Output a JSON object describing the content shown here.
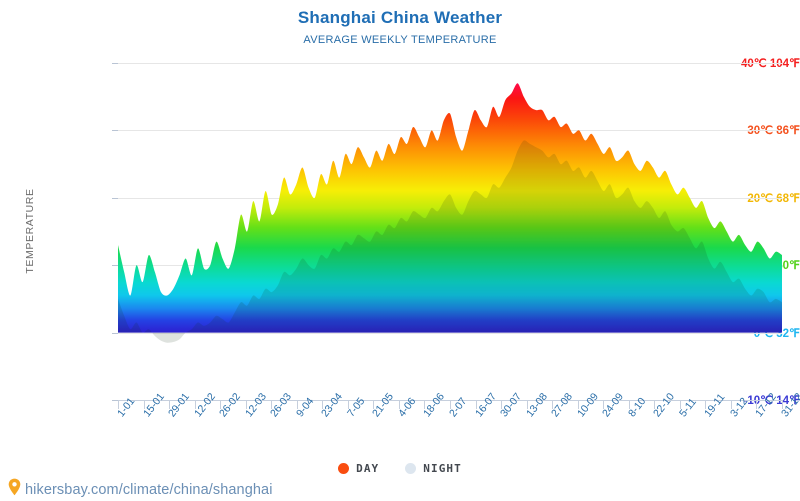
{
  "header": {
    "title": "Shanghai China Weather",
    "subtitle": "AVERAGE WEEKLY TEMPERATURE"
  },
  "axes": {
    "y_title": "TEMPERATURE"
  },
  "legend": {
    "items": [
      {
        "label": "DAY",
        "color": "#f94d10"
      },
      {
        "label": "NIGHT",
        "color": "#dde6ef"
      }
    ]
  },
  "footer": {
    "url": "hikersbay.com/climate/china/shanghai",
    "pin_icon": "map-pin-icon",
    "pin_color": "#f5a623"
  },
  "chart_data": {
    "type": "area",
    "title": "Shanghai China Weather",
    "subtitle": "AVERAGE WEEKLY TEMPERATURE",
    "xlabel": "",
    "ylabel": "TEMPERATURE",
    "ylim": [
      -10,
      40
    ],
    "grid": true,
    "legend_position": "bottom-center",
    "y_ticks": [
      {
        "value": 40,
        "label": "40℃ 104℉",
        "color": "#f41f1f"
      },
      {
        "value": 30,
        "label": "30℃ 86℉",
        "color": "#f4511e"
      },
      {
        "value": 20,
        "label": "20℃ 68℉",
        "color": "#f2b705"
      },
      {
        "value": 10,
        "label": "10℃ 50℉",
        "color": "#52d11a"
      },
      {
        "value": 0,
        "label": "0℃ 32℉",
        "color": "#1fb6f0"
      },
      {
        "value": -10,
        "label": "-10℃ 14℉",
        "color": "#3a3ad4"
      }
    ],
    "categories": [
      "1-01",
      "15-01",
      "29-01",
      "12-02",
      "26-02",
      "12-03",
      "26-03",
      "9-04",
      "23-04",
      "7-05",
      "21-05",
      "4-06",
      "18-06",
      "2-07",
      "16-07",
      "30-07",
      "13-08",
      "27-08",
      "10-09",
      "24-09",
      "8-10",
      "22-10",
      "5-11",
      "19-11",
      "3-12",
      "17-12",
      "31-12"
    ],
    "series": [
      {
        "name": "DAY",
        "color": "#f94d10",
        "values": [
          13.0,
          9.0,
          5.5,
          10.0,
          7.5,
          11.5,
          9.0,
          6.0,
          5.5,
          6.5,
          8.5,
          11.0,
          8.5,
          12.5,
          9.5,
          10.0,
          13.5,
          11.0,
          9.5,
          12.5,
          17.5,
          15.0,
          19.5,
          16.5,
          21.0,
          17.5,
          19.0,
          23.0,
          20.5,
          22.0,
          24.5,
          21.5,
          20.0,
          23.5,
          22.0,
          25.5,
          23.0,
          26.5,
          25.0,
          27.5,
          26.0,
          24.5,
          27.0,
          25.5,
          28.0,
          26.5,
          29.0,
          28.0,
          30.5,
          29.0,
          27.5,
          30.0,
          28.5,
          31.5,
          32.5,
          29.0,
          27.0,
          30.0,
          33.0,
          31.5,
          30.5,
          33.5,
          32.0,
          34.5,
          35.5,
          37.0,
          35.0,
          33.5,
          33.0,
          33.0,
          31.5,
          32.0,
          30.5,
          31.0,
          29.5,
          30.0,
          28.5,
          29.5,
          28.0,
          26.5,
          27.5,
          25.5,
          26.0,
          27.0,
          25.0,
          24.0,
          25.5,
          24.5,
          23.0,
          24.0,
          22.0,
          20.5,
          21.5,
          20.0,
          18.5,
          19.5,
          17.0,
          15.5,
          16.5,
          15.0,
          13.5,
          14.5,
          13.0,
          12.0,
          13.5,
          12.5,
          11.0,
          12.0,
          11.5
        ]
      },
      {
        "name": "NIGHT",
        "color": "#dde6ef",
        "values": [
          5.0,
          2.5,
          0.5,
          1.5,
          0.0,
          0.5,
          -0.5,
          -1.2,
          -1.5,
          -1.4,
          -1.0,
          0.0,
          0.5,
          1.5,
          1.0,
          1.5,
          2.5,
          2.0,
          1.5,
          3.0,
          4.5,
          4.0,
          5.5,
          5.0,
          6.5,
          6.0,
          7.0,
          9.0,
          8.5,
          9.5,
          11.0,
          10.0,
          9.5,
          11.5,
          11.0,
          12.5,
          12.0,
          13.5,
          13.0,
          14.5,
          14.0,
          13.5,
          15.0,
          14.5,
          16.0,
          15.5,
          17.0,
          16.5,
          18.0,
          17.5,
          17.0,
          18.5,
          18.0,
          19.5,
          20.5,
          18.5,
          17.5,
          19.5,
          21.0,
          20.5,
          20.0,
          22.0,
          21.5,
          23.0,
          24.5,
          27.0,
          28.5,
          28.0,
          27.5,
          27.0,
          26.0,
          26.5,
          25.0,
          25.5,
          24.0,
          24.5,
          23.0,
          24.0,
          22.5,
          21.0,
          22.0,
          20.0,
          20.5,
          21.5,
          19.5,
          18.5,
          19.5,
          18.5,
          17.0,
          18.0,
          16.0,
          15.0,
          15.5,
          14.0,
          12.5,
          13.5,
          11.0,
          9.5,
          10.5,
          9.0,
          7.5,
          8.0,
          6.5,
          5.5,
          6.5,
          6.0,
          4.5,
          5.0,
          4.5
        ]
      }
    ]
  }
}
